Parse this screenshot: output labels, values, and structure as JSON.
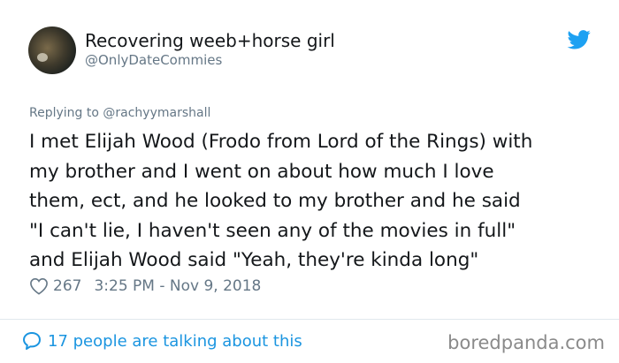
{
  "tweet": {
    "display_name": "Recovering weeb+horse girl",
    "handle": "@OnlyDateCommies",
    "replying_prefix": "Replying to",
    "replying_to": "@rachyymarshall",
    "lines": [
      "I met Elijah Wood (Frodo from Lord of the Rings) with",
      "my brother and I went on about how much I love",
      "them, ect, and he looked to my brother and he said",
      "\"I can't lie, I haven't seen any of the movies in full\"",
      "and Elijah Wood said \"Yeah, they're kinda long\""
    ],
    "likes": "267",
    "timestamp": "3:25 PM - Nov 9, 2018",
    "talking": "17 people are talking about this"
  },
  "watermark": "boredpanda.com",
  "colors": {
    "twitter_blue": "#1da1f2",
    "link_blue": "#1b95e0",
    "secondary_text": "#657786",
    "primary_text": "#14171a"
  },
  "icons": {
    "brand": "twitter-bird-icon",
    "like": "heart-outline-icon",
    "reply": "speech-bubble-icon"
  }
}
